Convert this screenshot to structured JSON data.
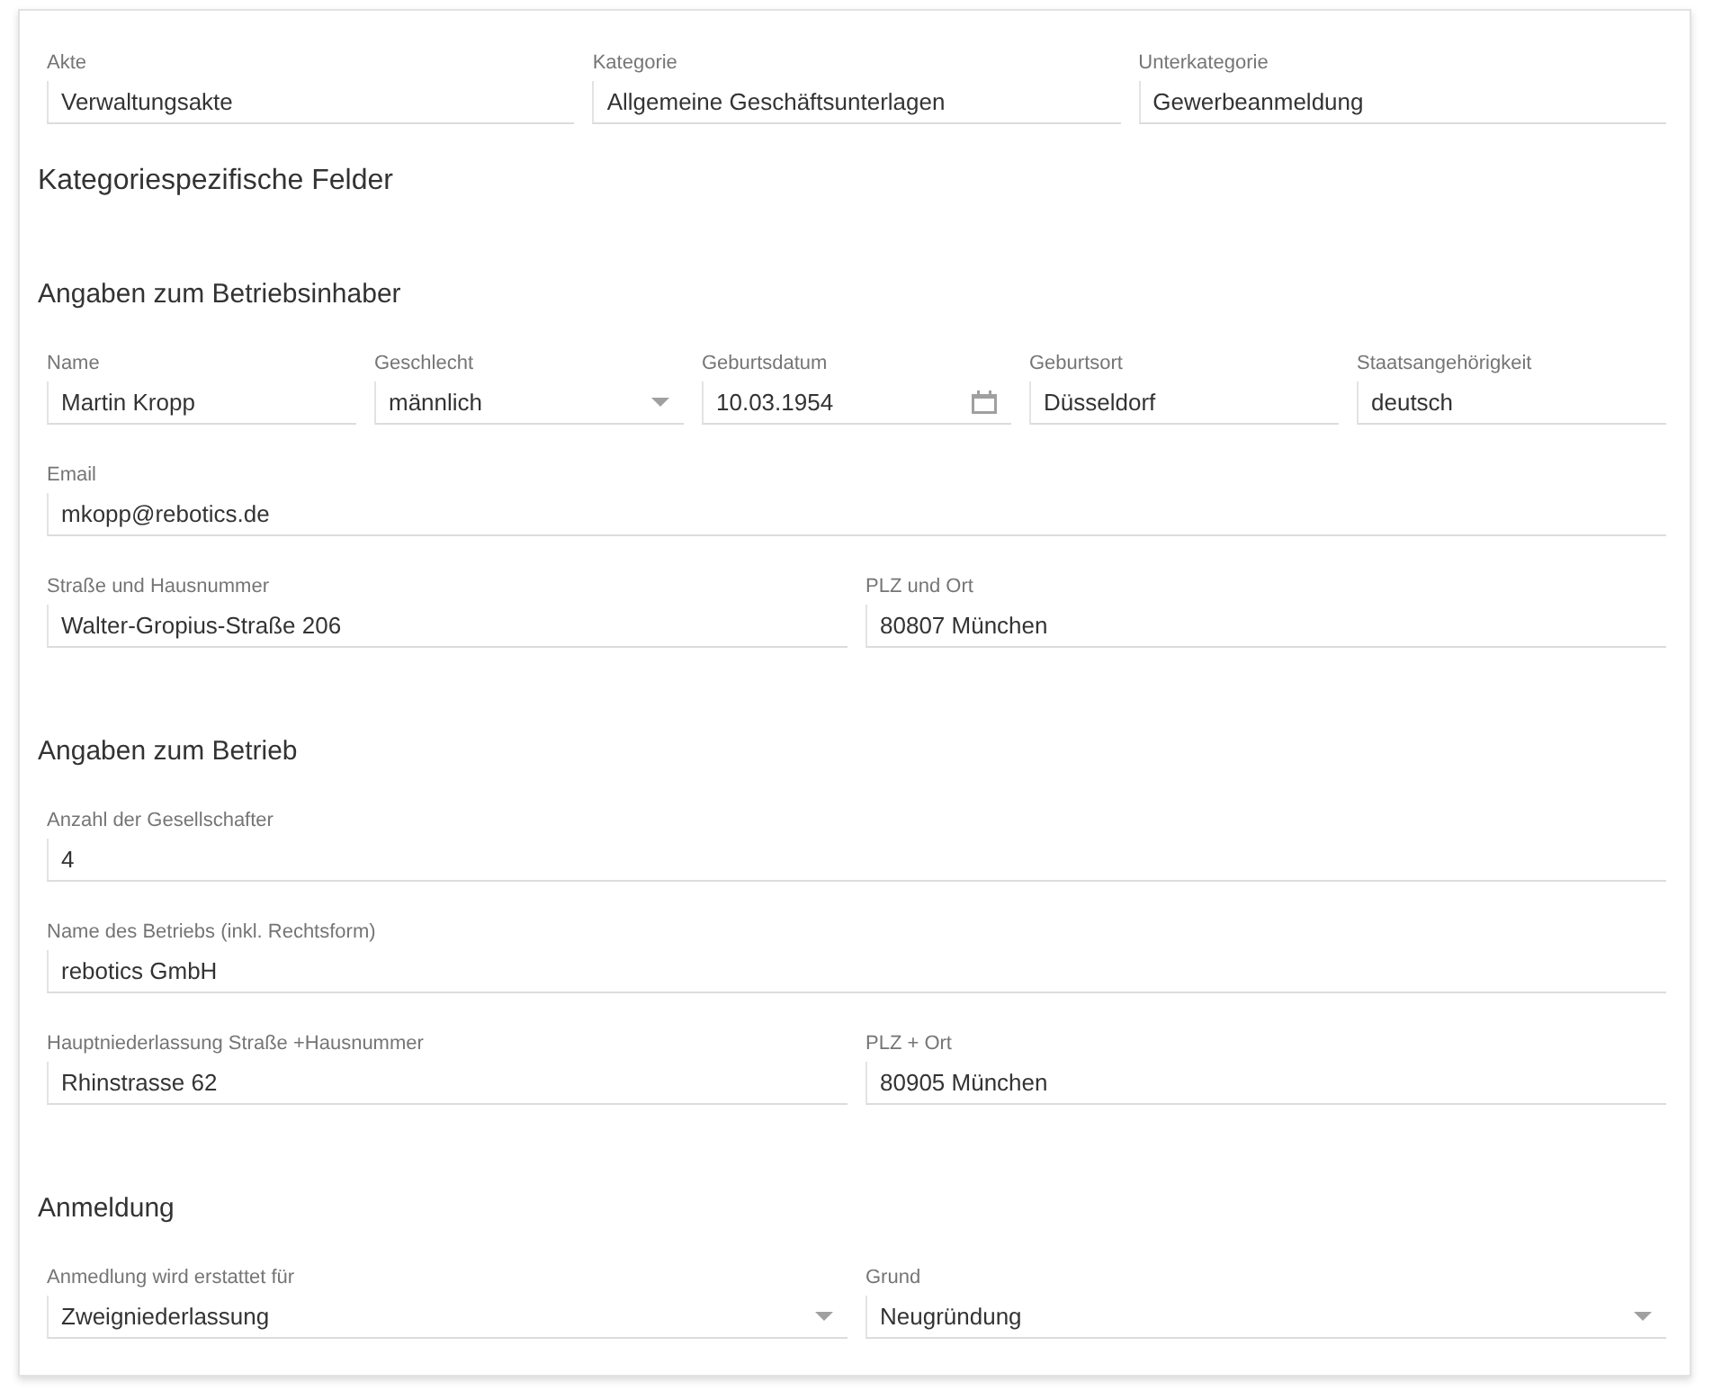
{
  "top_fields": [
    {
      "label": "Akte",
      "value": "Verwaltungsakte",
      "kind": "text"
    },
    {
      "label": "Kategorie",
      "value": "Allgemeine Geschäftsunterlagen",
      "kind": "text"
    },
    {
      "label": "Unterkategorie",
      "value": "Gewerbeanmeldung",
      "kind": "text"
    }
  ],
  "heading": "Kategoriespezifische Felder",
  "sections": [
    {
      "title": "Angaben zum Betriebsinhaber",
      "rows": [
        [
          {
            "label": "Name",
            "value": "Martin Kropp",
            "kind": "text"
          },
          {
            "label": "Geschlecht",
            "value": "männlich",
            "kind": "select"
          },
          {
            "label": "Geburtsdatum",
            "value": "10.03.1954",
            "kind": "date"
          },
          {
            "label": "Geburtsort",
            "value": "Düsseldorf",
            "kind": "text"
          },
          {
            "label": "Staatsangehörigkeit",
            "value": "deutsch",
            "kind": "text"
          }
        ],
        [
          {
            "label": "Email",
            "value": "mkopp@rebotics.de",
            "kind": "text"
          }
        ],
        [
          {
            "label": "Straße und Hausnummer",
            "value": "Walter-Gropius-Straße 206",
            "kind": "text"
          },
          {
            "label": "PLZ und Ort",
            "value": "80807 München",
            "kind": "text"
          }
        ]
      ]
    },
    {
      "title": "Angaben zum Betrieb",
      "rows": [
        [
          {
            "label": "Anzahl der Gesellschafter",
            "value": "4",
            "kind": "text"
          }
        ],
        [
          {
            "label": "Name des Betriebs (inkl. Rechtsform)",
            "value": "rebotics GmbH",
            "kind": "text"
          }
        ],
        [
          {
            "label": "Hauptniederlassung Straße +Hausnummer",
            "value": "Rhinstrasse 62",
            "kind": "text"
          },
          {
            "label": "PLZ + Ort",
            "value": "80905 München",
            "kind": "text"
          }
        ]
      ]
    },
    {
      "title": "Anmeldung",
      "rows": [
        [
          {
            "label": "Anmedlung wird erstattet für",
            "value": "Zweigniederlassung",
            "kind": "select"
          },
          {
            "label": "Grund",
            "value": "Neugründung",
            "kind": "select"
          }
        ]
      ]
    }
  ]
}
